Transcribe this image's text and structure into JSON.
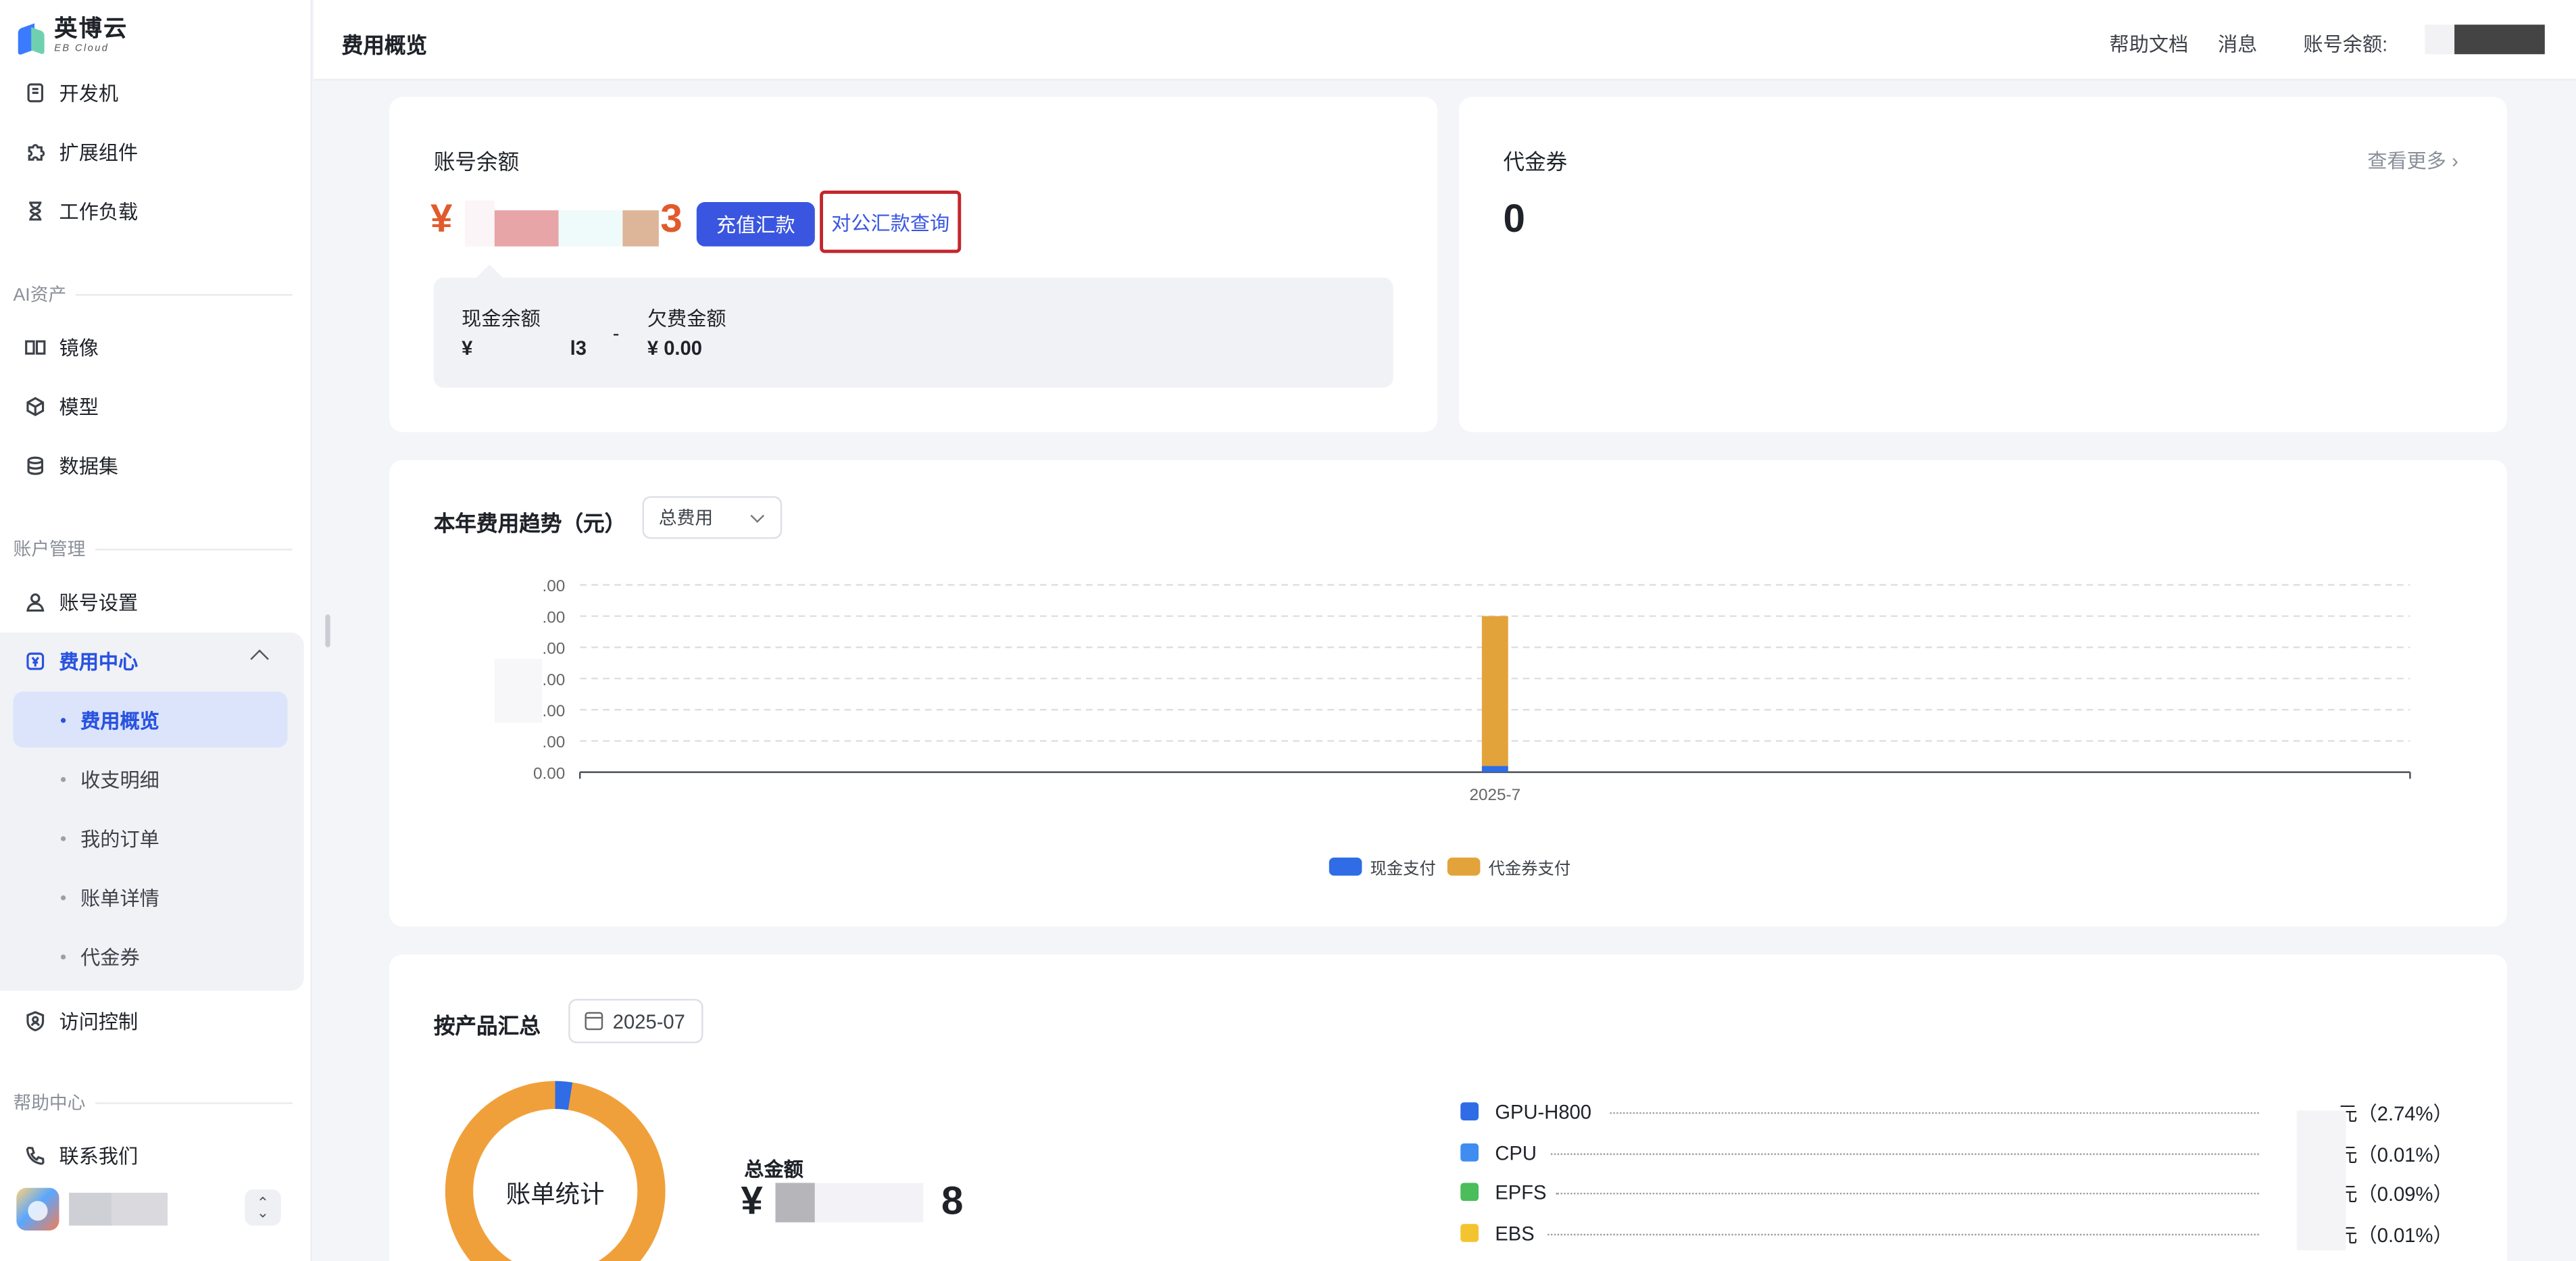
{
  "app": {
    "logo_cn": "英博云",
    "logo_en": "EB Cloud"
  },
  "sidebar": {
    "top_items": [
      {
        "label": "开发机",
        "icon": "dev-machine-icon"
      },
      {
        "label": "扩展组件",
        "icon": "puzzle-icon"
      },
      {
        "label": "工作负载",
        "icon": "hourglass-icon"
      }
    ],
    "section_ai": "AI资产",
    "ai_items": [
      {
        "label": "镜像",
        "icon": "mirror-icon"
      },
      {
        "label": "模型",
        "icon": "cube-icon"
      },
      {
        "label": "数据集",
        "icon": "database-icon"
      }
    ],
    "section_account": "账户管理",
    "account_settings": "账号设置",
    "fee_center": "费用中心",
    "fee_sub": [
      "费用概览",
      "收支明细",
      "我的订单",
      "账单详情",
      "代金券"
    ],
    "access_control": "访问控制",
    "section_help": "帮助中心",
    "contact": "联系我们"
  },
  "header": {
    "title": "费用概览",
    "help_docs": "帮助文档",
    "messages": "消息",
    "balance_label": "账号余额:"
  },
  "balance_card": {
    "title": "账号余额",
    "currency": "¥",
    "amount_tail": "3",
    "recharge_button": "充值汇款",
    "query_button": "对公汇款查询",
    "cash_label": "现金余额",
    "cash_value_prefix": "¥",
    "cash_value_tail": "l3",
    "separator": "-",
    "arrears_label": "欠费金额",
    "arrears_value": "¥ 0.00"
  },
  "coupon_card": {
    "title": "代金券",
    "more": "查看更多",
    "count": "0"
  },
  "trend_card": {
    "title": "本年费用趋势（元）",
    "select_value": "总费用",
    "legend": [
      {
        "label": "现金支付",
        "color": "#2f6ce5"
      },
      {
        "label": "代金券支付",
        "color": "#e3a33b"
      }
    ]
  },
  "chart_data": {
    "type": "bar",
    "stacked": true,
    "categories": [
      "2025-7"
    ],
    "series": [
      {
        "name": "现金支付",
        "values": [
          0.2
        ],
        "color": "#2f6ce5"
      },
      {
        "name": "代金券支付",
        "values": [
          4.8
        ],
        "color": "#e3a33b"
      }
    ],
    "y_tick_labels": [
      ".00",
      ".00",
      ".00",
      ".00",
      ".00",
      ".00",
      "0.00"
    ],
    "ylim": [
      0,
      6
    ],
    "grid": true,
    "legend_position": "bottom"
  },
  "product_card": {
    "title": "按产品汇总",
    "date": "2025-07",
    "donut_label": "账单统计",
    "total_label": "总金额",
    "total_prefix": "¥",
    "total_tail": "8",
    "products": [
      {
        "name": "GPU-H800",
        "pct": "元（2.74%）",
        "color": "#2f6ce5"
      },
      {
        "name": "CPU",
        "pct": "元（0.01%）",
        "color": "#3f8df0"
      },
      {
        "name": "EPFS",
        "pct": "元（0.09%）",
        "color": "#4bbd5a"
      },
      {
        "name": "EBS",
        "pct": "元（0.01%）",
        "color": "#f4c430"
      }
    ]
  }
}
